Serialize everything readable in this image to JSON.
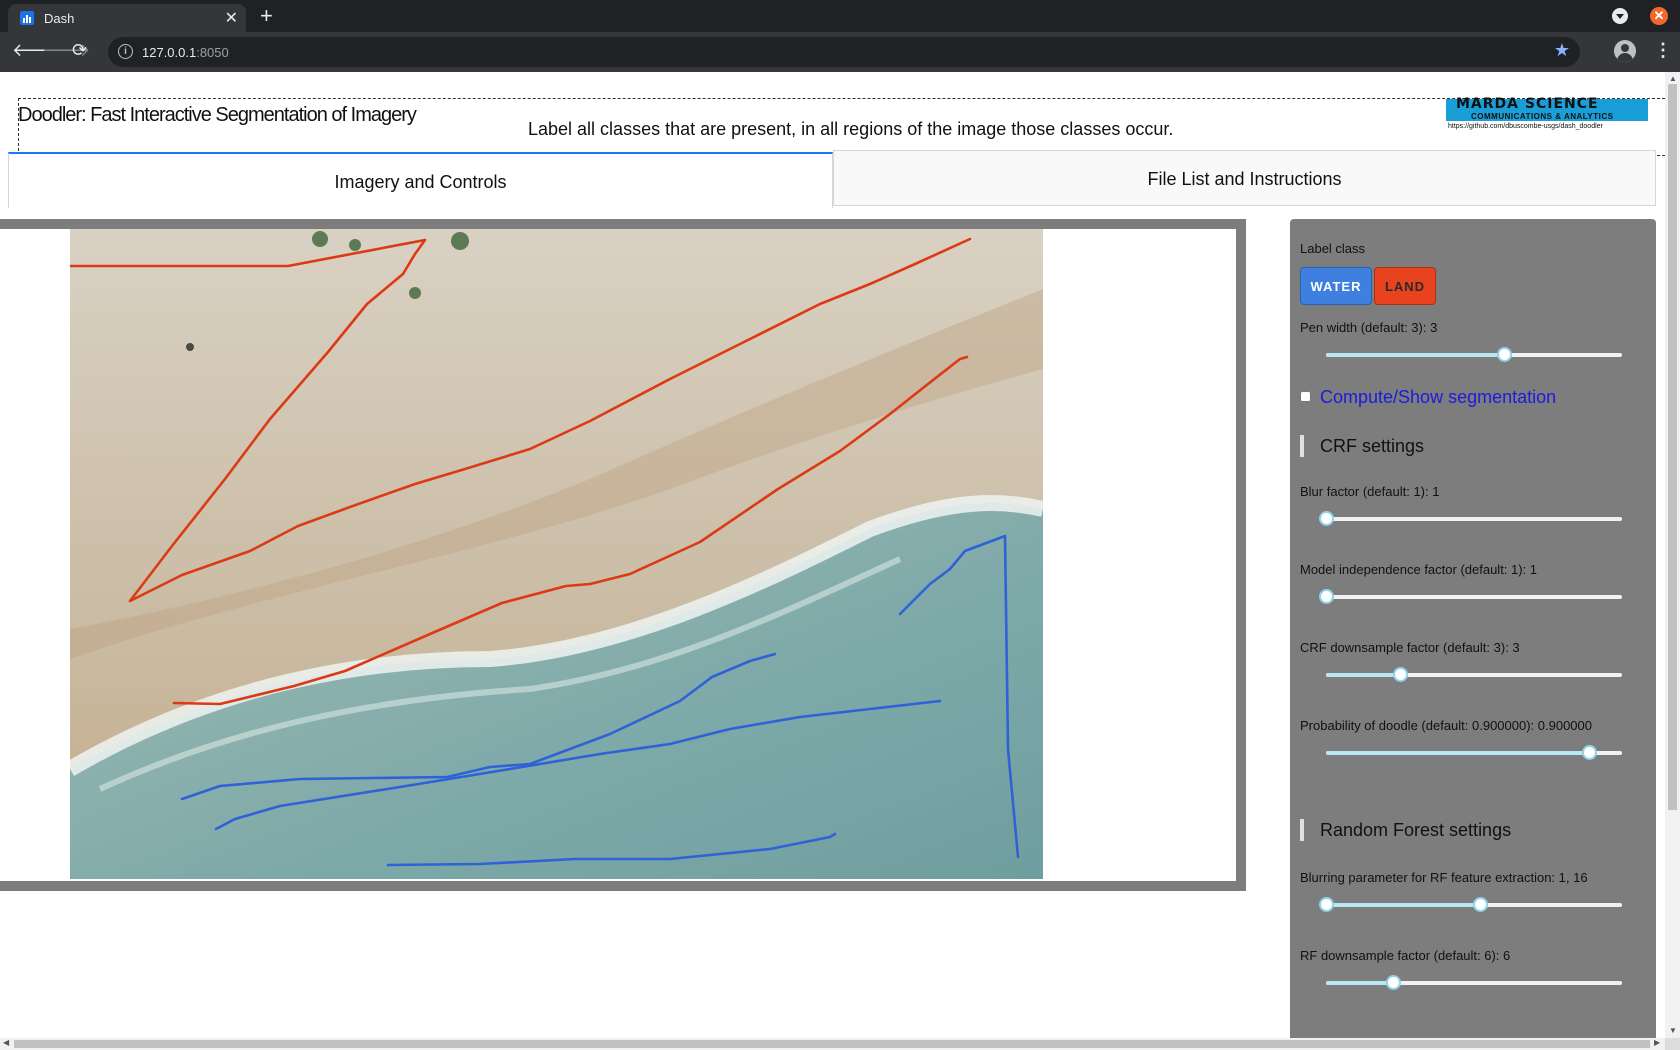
{
  "browser": {
    "tab_title": "Dash",
    "url_host": "127.0.0.1",
    "url_port": ":8050",
    "icons": [
      "bar-chart-favicon",
      "close-icon",
      "plus-icon",
      "back-icon",
      "forward-icon",
      "reload-icon",
      "info-icon",
      "star-icon",
      "profile-icon",
      "kebab-menu-icon"
    ]
  },
  "header": {
    "title": "Doodler: Fast Interactive Segmentation of Imagery",
    "subtitle": "Label all classes that are present, in all regions of the image those classes occur.",
    "logo": {
      "line1": "MARDA SCIENCE",
      "line2": "COMMUNICATIONS & ANALYTICS",
      "line3": "https://github.com/dbuscombe-usgs/dash_doodler"
    }
  },
  "tabs": [
    {
      "label": "Imagery and Controls",
      "active": true
    },
    {
      "label": "File List and Instructions",
      "active": false
    }
  ],
  "controls": {
    "label_class": "Label class",
    "classes": [
      {
        "label": "WATER",
        "color": "#3f7fe0"
      },
      {
        "label": "LAND",
        "color": "#e8431e"
      }
    ],
    "pen_width": {
      "label": "Pen width (default: 3): 3",
      "value": 3,
      "min": 1,
      "max": 5
    },
    "segmentation_checkbox": {
      "label": "Compute/Show segmentation",
      "checked": false
    },
    "crf_heading": "CRF settings",
    "crf_sliders": [
      {
        "label": "Blur factor (default: 1): 1",
        "fraction": 0.0
      },
      {
        "label": "Model independence factor (default: 1): 1",
        "fraction": 0.0
      },
      {
        "label": "CRF downsample factor (default: 3): 3",
        "fraction": 0.25
      },
      {
        "label": "Probability of doodle (default: 0.900000): 0.900000",
        "fraction": 0.89
      }
    ],
    "rf_heading": "Random Forest settings",
    "rf_blur": {
      "label": "Blurring parameter for RF feature extraction: 1, 16",
      "range": [
        0.0,
        0.52
      ]
    },
    "rf_downsample": {
      "label": "RF downsample factor (default: 6): 6",
      "fraction": 0.225
    }
  },
  "colors": {
    "water_stroke": "#2f62d6",
    "land_stroke": "#dc3a14",
    "panel_bg": "#7d7d7d",
    "active_tab_accent": "#1975fa"
  }
}
